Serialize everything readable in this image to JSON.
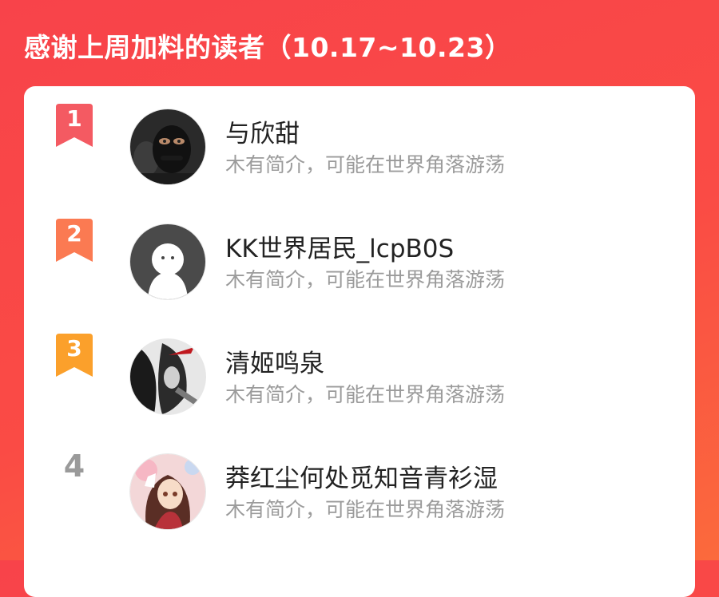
{
  "header": {
    "title": "感谢上周加料的读者（10.17~10.23）"
  },
  "colors": {
    "background": "#f8434a",
    "rank1": "#f45a62",
    "rank2": "#fb7a52",
    "rank3": "#fba02b",
    "rank_plain": "#9a9a9a"
  },
  "readers": [
    {
      "rank": "1",
      "name": "与欣甜",
      "intro": "木有简介，可能在世界角落游荡",
      "avatar": "masked-person-avatar"
    },
    {
      "rank": "2",
      "name": "KK世界居民_lcpB0S",
      "intro": "木有简介，可能在世界角落游荡",
      "avatar": "default-ghost-avatar"
    },
    {
      "rank": "3",
      "name": "清姬鸣泉",
      "intro": "木有简介，可能在世界角落游荡",
      "avatar": "anime-dark-avatar"
    },
    {
      "rank": "4",
      "name": "莽红尘何处觅知音青衫湿",
      "intro": "木有简介，可能在世界角落游荡",
      "avatar": "anime-girl-avatar"
    }
  ]
}
